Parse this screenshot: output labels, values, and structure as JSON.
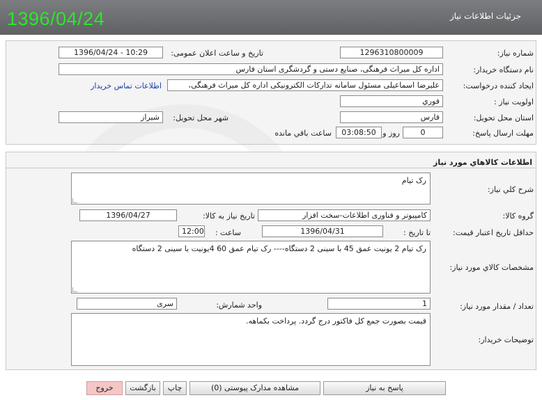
{
  "header": {
    "title": "جزئیات اطلاعات نیاز",
    "date": "1396/04/24"
  },
  "info": {
    "need_number_label": "شماره نیاز:",
    "need_number": "1296310800009",
    "announce_label": "تاریخ و ساعت اعلان عمومی:",
    "announce_value": "1396/04/24 - 10:29",
    "buyer_label": "نام دستگاه خریدار:",
    "buyer_value": "اداره کل میراث فرهنگی، صنایع دستی و گردشگری استان فارس",
    "creator_label": "ایجاد کننده درخواست:",
    "creator_value": "علیرضا اسماعیلی مسئول سامانه تدارکات الکترونیکی اداره کل میراث فرهنگی،",
    "contact_link": "اطلاعات تماس خریدار",
    "priority_label": "اولویت نیاز :",
    "priority_value": "فوري",
    "province_label": "استان محل تحویل:",
    "province_value": "فارس",
    "city_label": "شهر محل تحویل:",
    "city_value": "شیراز",
    "deadline_label": "مهلت ارسال پاسخ:",
    "days_value": "0",
    "days_unit": "روز و",
    "time_value": "03:08:50",
    "time_unit": "ساعت باقي مانده"
  },
  "goods": {
    "section_title": "اطلاعات کالاهاي مورد نياز",
    "desc_label": "شرح کلي نياز:",
    "desc_value": "رک تیام",
    "group_label": "گروه کالا:",
    "group_value": "کامپیوتر و فناوری اطلاعات-سخت افزار",
    "need_date_label": "تاريخ نياز به کالا:",
    "need_date_value": "1396/04/27",
    "validity_label": "حداقل تاريخ اعتبار قيمت:",
    "until_label": "تا تاريخ :",
    "validity_date": "1396/04/31",
    "hour_label": "ساعت :",
    "hour_value": "12:00",
    "spec_label": "مشخصات کالاي مورد نياز:",
    "spec_value": "رک تیام 2 یونیت عمق 45 با سینی 2 دستگاه---- رک تیام عمق 60  4یونیت با سینی 2 دستگاه",
    "qty_label": "تعداد / مقدار مورد نياز:",
    "qty_value": "1",
    "unit_label": "واحد شمارش:",
    "unit_value": "سری",
    "notes_label": "توضيحات خريدار:",
    "notes_value": "قیمت بصورت جمع کل فاکتور درج گردد. پرداخت  بکماهه."
  },
  "buttons": {
    "reply": "پاسخ به نياز",
    "attachments": "مشاهده مدارک پیوستی (0)",
    "print": "چاپ",
    "back": "بازگشت",
    "exit": "خروج"
  }
}
